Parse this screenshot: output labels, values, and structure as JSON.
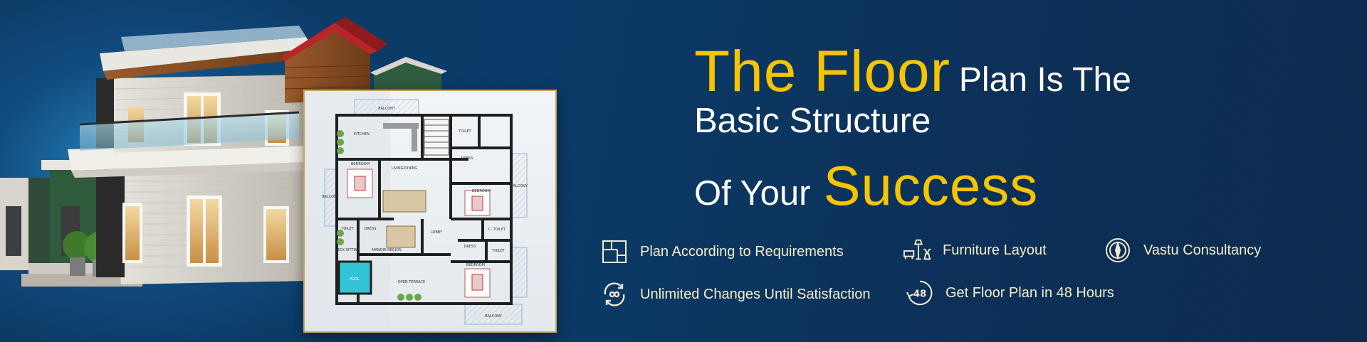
{
  "headline": {
    "part1": "The Floor",
    "part2": "Plan Is The",
    "part3": "Basic Structure",
    "part4": "Of Your",
    "part5": "Success"
  },
  "features": [
    {
      "label": "Plan According to Requirements",
      "icon": "floor-plan-icon"
    },
    {
      "label": "Furniture Layout",
      "icon": "furniture-icon"
    },
    {
      "label": "Vastu Consultancy",
      "icon": "compass-icon"
    },
    {
      "label": "Unlimited Changes Until Satisfaction",
      "icon": "infinity-refresh-icon"
    },
    {
      "label": "Get Floor Plan in 48 Hours",
      "icon": "48-hours-icon"
    }
  ],
  "plan_labels": {
    "balcony_top": "BALCONY",
    "kitchen": "KITCHEN",
    "toilet1": "TOILET",
    "dress1": "DRESS",
    "bedroom1": "BEDROOM",
    "balcony_left": "BALCONY",
    "dining": "LIVING/DINING",
    "bedroom2": "BEDROOM",
    "balcony_right": "BALCONY",
    "toilet2": "TOILET",
    "dress2": "DRESS",
    "ctoilet": "C. TOILET",
    "lobby": "LOBBY",
    "deck": "DECK SITTING",
    "mandir": "MANDIR REGION",
    "dress3": "DRESS",
    "toilet3": "TOILET",
    "bedroom3": "BEDROOM",
    "pool": "POOL",
    "open_terrace": "OPEN TERRACE",
    "balcony_bottom": "BALCONY"
  },
  "colors": {
    "accent_yellow": "#f7c500",
    "feature_text": "#f5eec8",
    "bg_blue": "#0a3a66"
  }
}
